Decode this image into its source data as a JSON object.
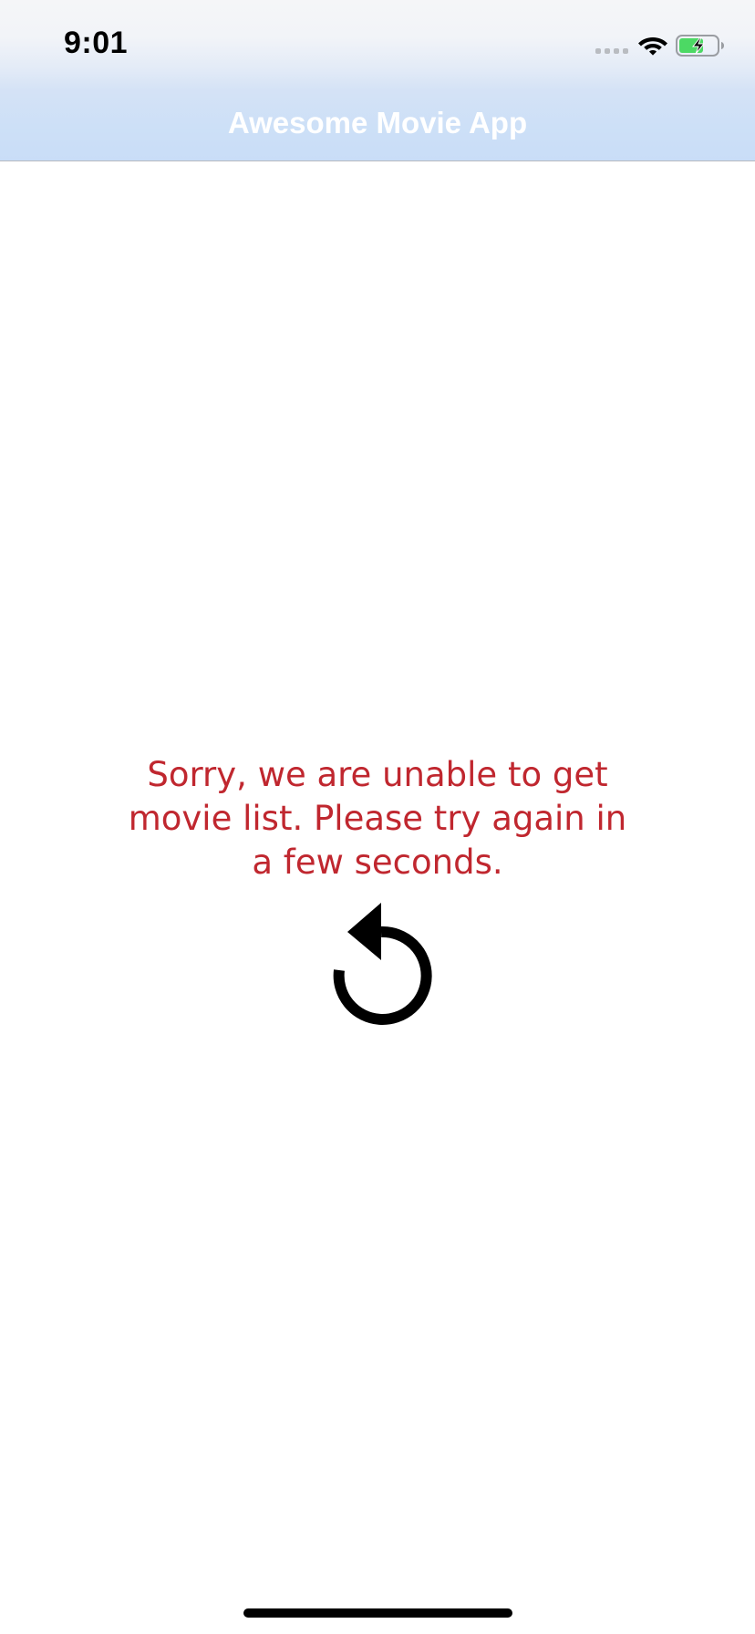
{
  "status_bar": {
    "time": "9:01",
    "signal_icon": "cellular-signal-icon",
    "wifi_icon": "wifi-icon",
    "battery_icon": "battery-charging-icon",
    "battery_color": "#4cd964"
  },
  "nav_bar": {
    "title": "Awesome Movie App"
  },
  "main": {
    "error_message": "Sorry, we are unable to get movie list. Please try again in a few seconds.",
    "error_color": "#c0272f",
    "retry_icon": "refresh-icon"
  }
}
